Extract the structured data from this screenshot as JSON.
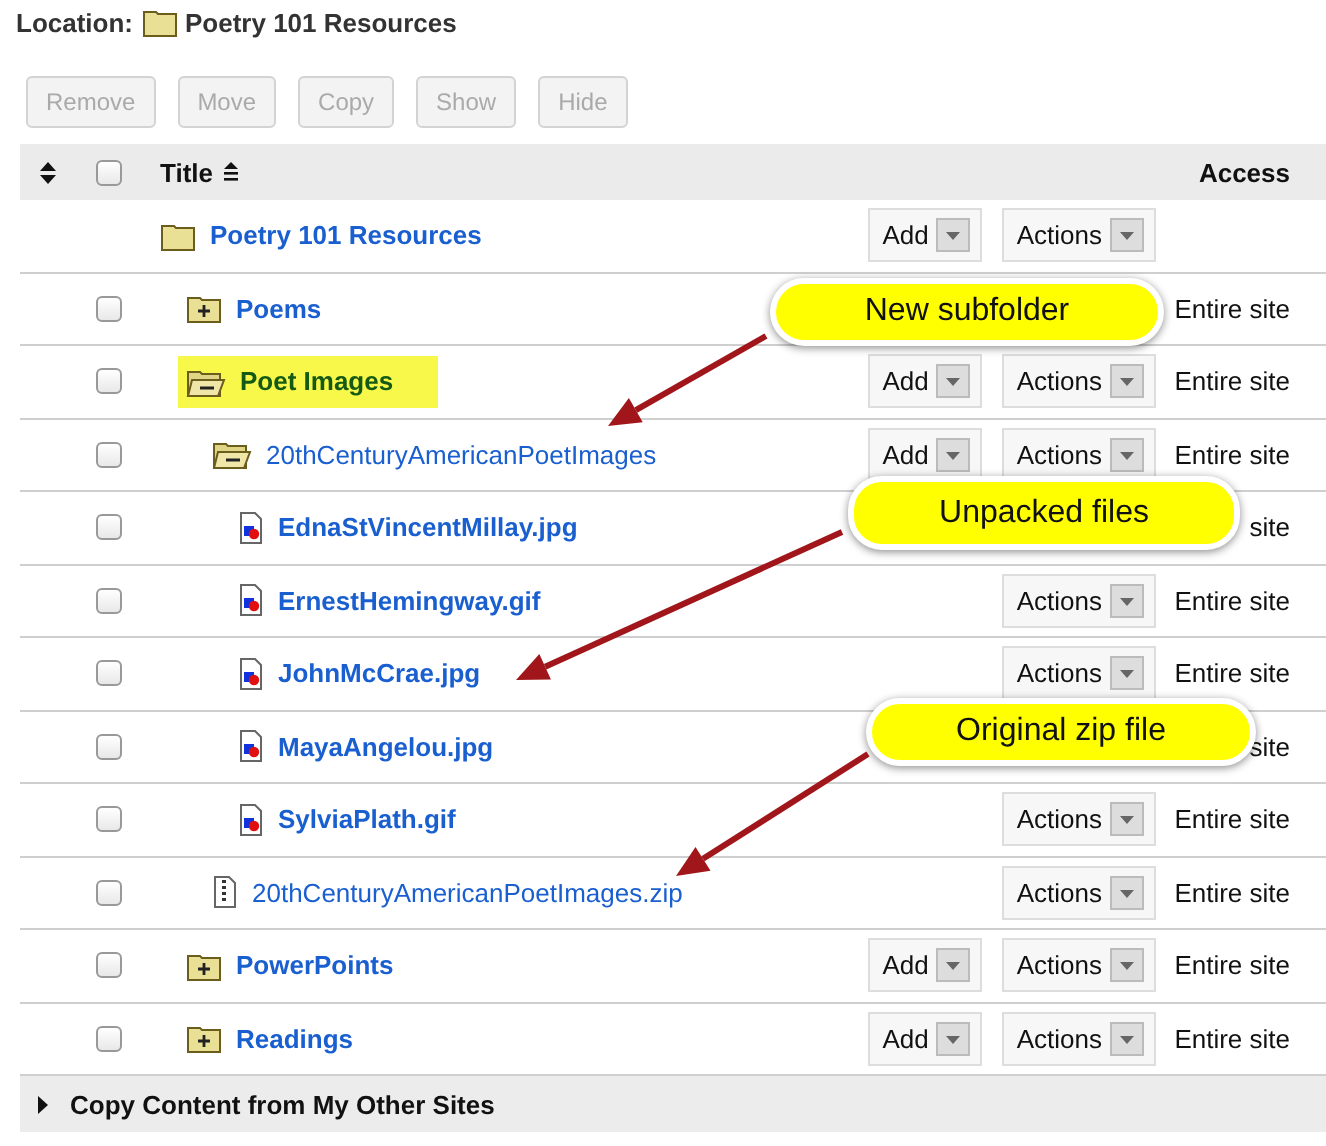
{
  "location": {
    "label": "Location:",
    "folder": "Poetry 101 Resources"
  },
  "toolbar": [
    {
      "label": "Remove",
      "disabled": true
    },
    {
      "label": "Move",
      "disabled": true
    },
    {
      "label": "Copy",
      "disabled": true
    },
    {
      "label": "Show",
      "disabled": true
    },
    {
      "label": "Hide",
      "disabled": true
    }
  ],
  "table": {
    "columns": {
      "title": "Title",
      "access": "Access"
    },
    "select_all": {
      "checked": false
    },
    "rows": [
      {
        "kind": "root",
        "title": "Poetry 101 Resources",
        "bold": true,
        "highlighted": false,
        "add": "Add",
        "actions": "Actions",
        "children": [
          {
            "kind": "folder",
            "title": "Poems",
            "expanded": false,
            "bold": true,
            "highlighted": false,
            "checked": false,
            "access": "Entire site"
          },
          {
            "kind": "folder",
            "title": "Poet Images",
            "expanded": true,
            "bold": true,
            "highlighted": true,
            "checked": false,
            "add": "Add",
            "actions": "Actions",
            "access": "Entire site",
            "children": [
              {
                "kind": "folder",
                "title": "20thCenturyAmericanPoetImages",
                "expanded": true,
                "bold": false,
                "highlighted": false,
                "checked": false,
                "add": "Add",
                "actions": "Actions",
                "access": "Entire site",
                "children": [
                  {
                    "kind": "image",
                    "title": "EdnaStVincentMillay.jpg",
                    "bold": true,
                    "highlighted": false,
                    "checked": false,
                    "access": "site"
                  },
                  {
                    "kind": "image",
                    "title": "ErnestHemingway.gif",
                    "bold": true,
                    "highlighted": false,
                    "checked": false,
                    "actions": "Actions",
                    "access": "Entire site"
                  },
                  {
                    "kind": "image",
                    "title": "JohnMcCrae.jpg",
                    "bold": true,
                    "highlighted": false,
                    "checked": false,
                    "actions": "Actions",
                    "access": "Entire site"
                  },
                  {
                    "kind": "image",
                    "title": "MayaAngelou.jpg",
                    "bold": true,
                    "highlighted": false,
                    "checked": false,
                    "access": "site"
                  },
                  {
                    "kind": "image",
                    "title": "SylviaPlath.gif",
                    "bold": true,
                    "highlighted": false,
                    "checked": false,
                    "actions": "Actions",
                    "access": "Entire site"
                  }
                ]
              },
              {
                "kind": "zip",
                "title": "20thCenturyAmericanPoetImages.zip",
                "bold": false,
                "highlighted": false,
                "checked": false,
                "actions": "Actions",
                "access": "Entire site"
              }
            ]
          },
          {
            "kind": "folder",
            "title": "PowerPoints",
            "expanded": false,
            "bold": true,
            "highlighted": false,
            "checked": false,
            "add": "Add",
            "actions": "Actions",
            "access": "Entire site"
          },
          {
            "kind": "folder",
            "title": "Readings",
            "expanded": false,
            "bold": true,
            "highlighted": false,
            "checked": false,
            "add": "Add",
            "actions": "Actions",
            "access": "Entire site"
          }
        ]
      }
    ]
  },
  "callouts": [
    {
      "text": "New subfolder"
    },
    {
      "text": "Unpacked files"
    },
    {
      "text": "Original zip file"
    }
  ],
  "footer": {
    "label": "Copy Content from My Other Sites",
    "expanded": false
  }
}
